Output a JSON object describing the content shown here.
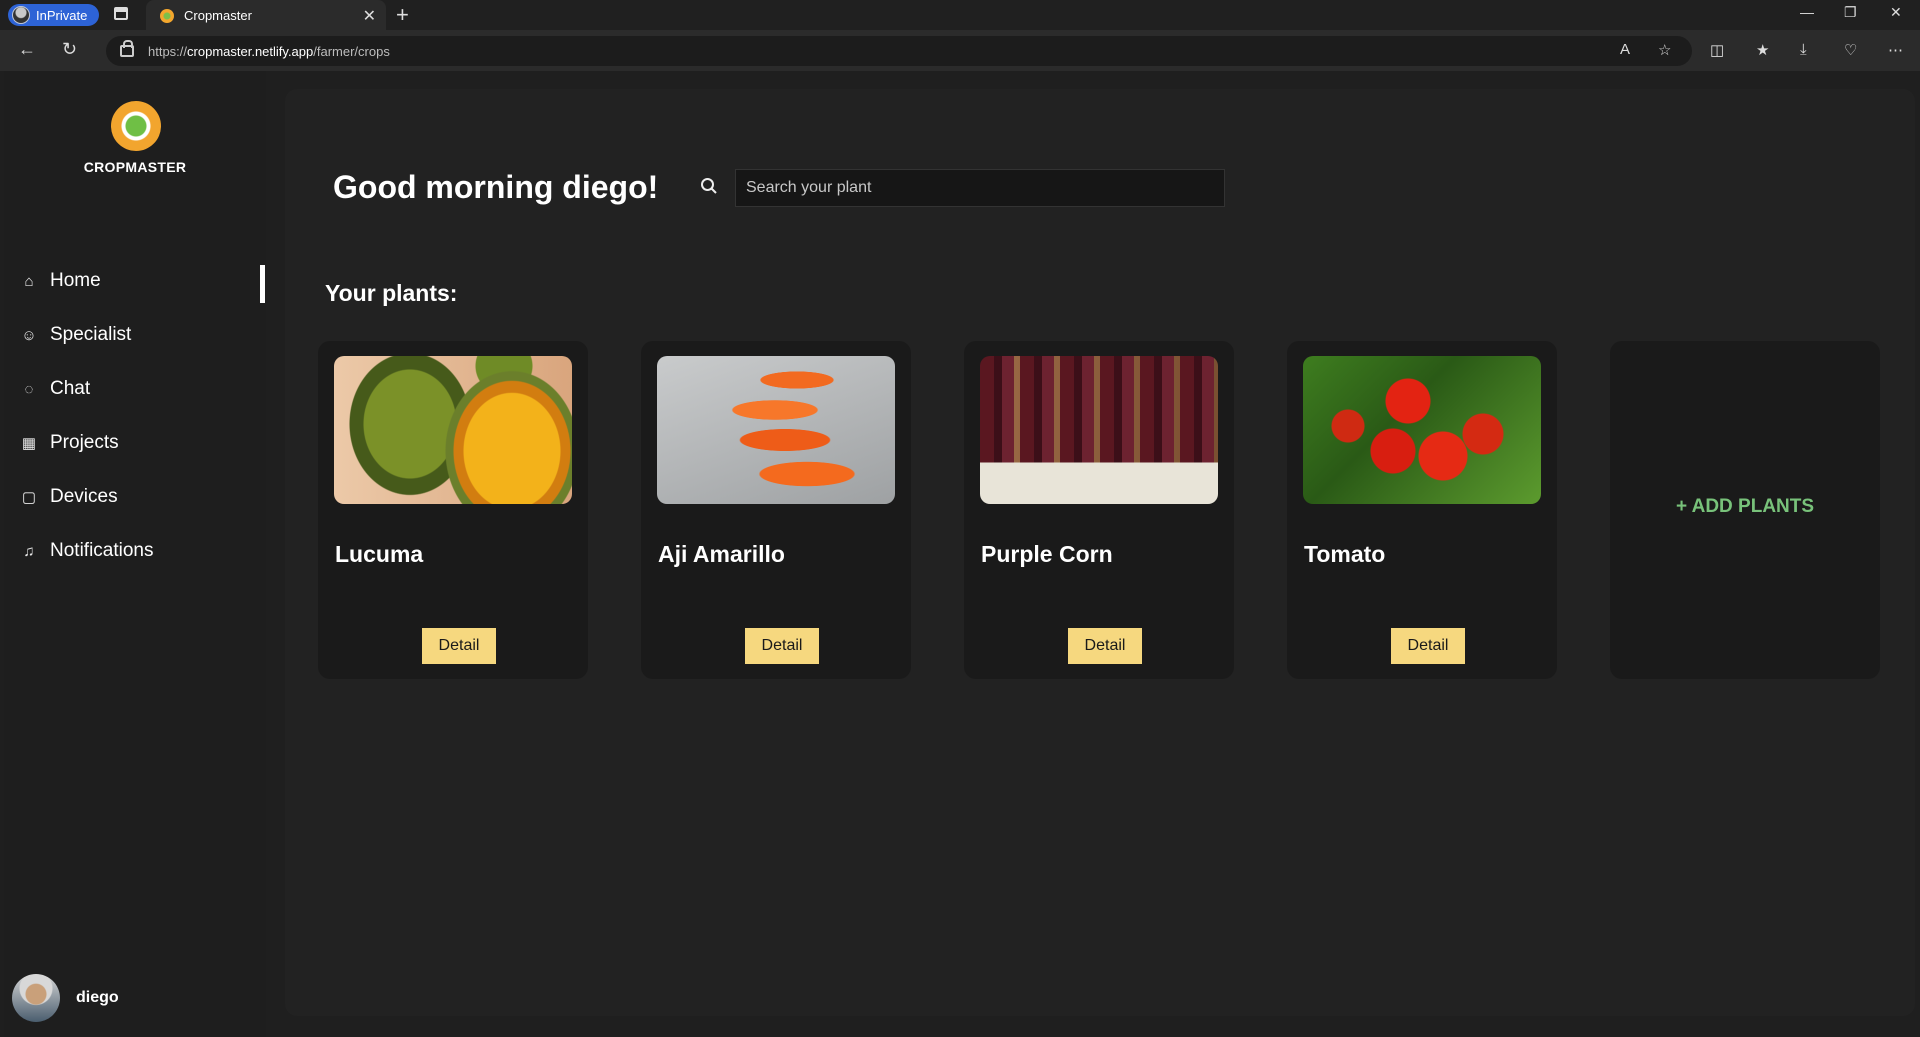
{
  "browser": {
    "inprivate_label": "InPrivate",
    "tab_title": "Cropmaster",
    "url_scheme": "https://",
    "url_host": "cropmaster.netlify.app",
    "url_path": "/farmer/crops"
  },
  "sidebar": {
    "brand": "CROPMASTER",
    "items": [
      {
        "label": "Home",
        "icon": "home-icon"
      },
      {
        "label": "Specialist",
        "icon": "user-icon"
      },
      {
        "label": "Chat",
        "icon": "chat-icon"
      },
      {
        "label": "Projects",
        "icon": "calendar-icon"
      },
      {
        "label": "Devices",
        "icon": "device-icon"
      },
      {
        "label": "Notifications",
        "icon": "bell-icon"
      }
    ],
    "active_item": "Home",
    "user": {
      "name": "diego"
    }
  },
  "main": {
    "greeting": "Good morning diego!",
    "search_placeholder": "Search your plant",
    "section_title": "Your plants:",
    "plants": [
      {
        "name": "Lucuma",
        "button": "Detail"
      },
      {
        "name": "Aji Amarillo",
        "button": "Detail"
      },
      {
        "name": "Purple Corn",
        "button": "Detail"
      },
      {
        "name": "Tomato",
        "button": "Detail"
      }
    ],
    "add_plants_label": "+ ADD PLANTS"
  },
  "colors": {
    "accent_button": "#f6d87f",
    "add_plants_text": "#78c27a",
    "background": "#1f1f1f"
  }
}
